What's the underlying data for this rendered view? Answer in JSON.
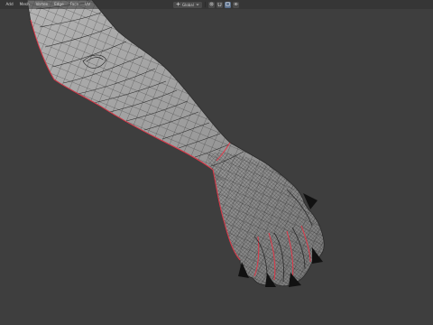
{
  "header": {
    "menu": [
      {
        "label": "Add"
      },
      {
        "label": "Mesh"
      },
      {
        "label": "Vertex"
      },
      {
        "label": "Edge"
      },
      {
        "label": "Face"
      },
      {
        "label": "UV"
      }
    ],
    "pivot_label": "Global",
    "icons": {
      "pivot": "transform-orientation-icon",
      "snap": "snap-icon",
      "proportional": "proportional-editing-icon",
      "overlay": "overlay-icon"
    }
  },
  "viewport": {
    "object": "arm-mesh",
    "mode": "edit",
    "colors": {
      "background": "#3e3e3e",
      "mesh_surface": "#9a9a9a",
      "wire": "#1c1c1c",
      "seam": "#e0394a",
      "claw": "#111111"
    }
  }
}
